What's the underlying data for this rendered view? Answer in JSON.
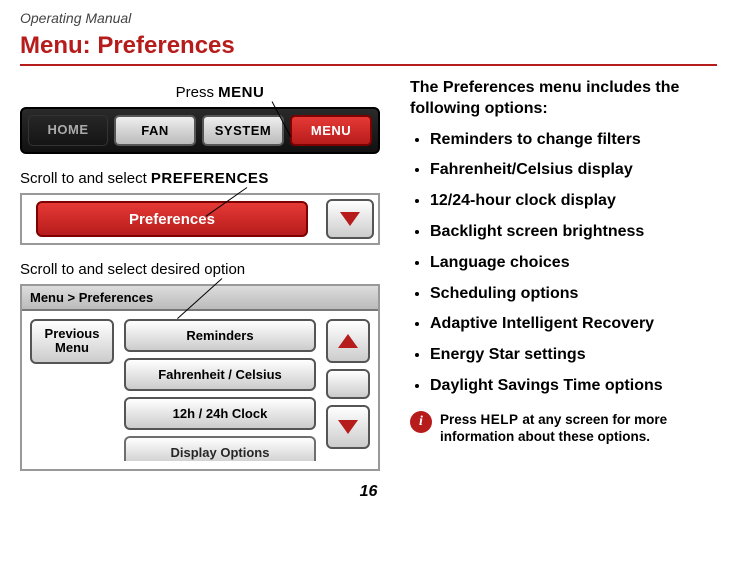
{
  "header": "Operating Manual",
  "title": "Menu: Preferences",
  "left": {
    "caption1_prefix": "Press ",
    "caption1_bold": "MENU",
    "nav": {
      "home": "HOME",
      "fan": "FAN",
      "system": "SYSTEM",
      "menu": "MENU"
    },
    "caption2_prefix": "Scroll to and select ",
    "caption2_bold": "PREFERENCES",
    "pref_button": "Preferences",
    "caption3": "Scroll to and select desired option",
    "breadcrumb": "Menu > Preferences",
    "prev_menu_l1": "Previous",
    "prev_menu_l2": "Menu",
    "options": [
      "Reminders",
      "Fahrenheit / Celsius",
      "12h / 24h Clock",
      "Display Options"
    ]
  },
  "right": {
    "intro": "The Preferences menu includes the following options:",
    "bullets": [
      "Reminders to change filters",
      "Fahrenheit/Celsius display",
      "12/24-hour clock display",
      "Backlight screen brightness",
      "Language choices",
      "Scheduling options",
      "Adaptive Intelligent Recovery",
      "Energy Star settings",
      "Daylight Savings Time options"
    ],
    "help_prefix": "Press ",
    "help_bold": "HELP",
    "help_suffix": " at any screen for more information about these options."
  },
  "page_number": "16"
}
